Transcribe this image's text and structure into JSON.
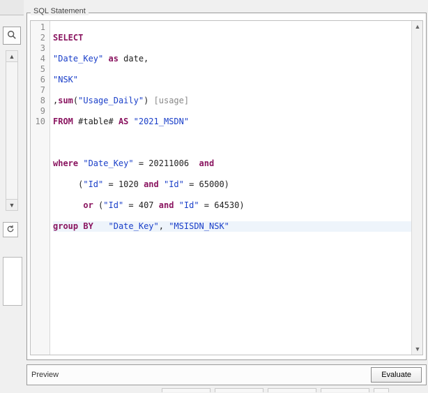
{
  "panel_title": "SQL Statement",
  "gutter": [
    "1",
    "2",
    "3",
    "4",
    "5",
    "6",
    "7",
    "8",
    "9",
    "10"
  ],
  "code": {
    "l1": {
      "kw": "SELECT"
    },
    "l2": {
      "str": "\"Date_Key\"",
      "kw": "as",
      "txt": " date,"
    },
    "l3": {
      "str": "\"NSK\""
    },
    "l4": {
      "txt1": ",",
      "kw": "sum",
      "txt2": "(",
      "str": "\"Usage_Daily\"",
      "txt3": ") ",
      "alias": "[usage]"
    },
    "l5": {
      "kw1": "FROM",
      "txt": " #table# ",
      "kw2": "AS",
      "str": " \"2021_MSDN\""
    },
    "l6": {
      "txt": ""
    },
    "l7": {
      "kw1": "where",
      "str": " \"Date_Key\"",
      "txt1": " = 20211006  ",
      "kw2": "and"
    },
    "l8": {
      "txt1": "     (",
      "str1": "\"Id\"",
      "txt2": " = 1020 ",
      "kw": "and",
      "str2": " \"Id\"",
      "txt3": " = 65000)"
    },
    "l9": {
      "txt1": "      ",
      "kw1": "or",
      "txt2": " (",
      "str1": "\"Id\"",
      "txt3": " = 407 ",
      "kw2": "and",
      "str2": " \"Id\"",
      "txt4": " = 64530)"
    },
    "l10": {
      "kw1": "group",
      "kw2": " BY",
      "txt": "   ",
      "str1": "\"Date_Key\"",
      "txt2": ", ",
      "str2": "\"MSISDN_NSK\""
    }
  },
  "preview": {
    "label": "Preview",
    "evaluate": "Evaluate"
  },
  "icons": {
    "search": "search-icon",
    "refresh": "refresh-icon"
  }
}
